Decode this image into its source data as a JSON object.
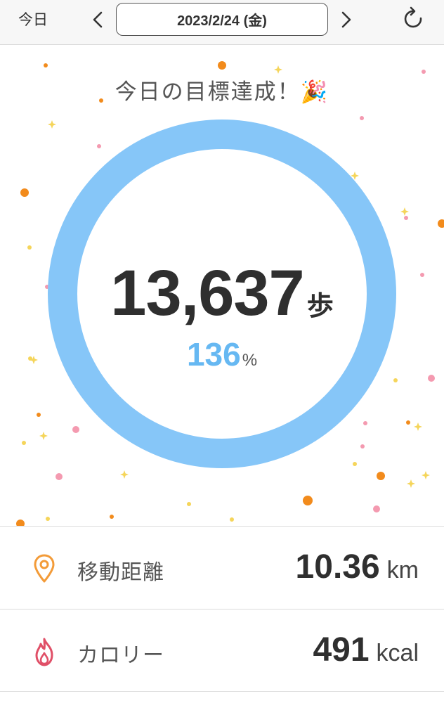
{
  "header": {
    "today_label": "今日",
    "date": "2023/2/24 (金)"
  },
  "main": {
    "goal_message": "今日の目標達成！🎉",
    "steps": "13,637",
    "steps_unit": "歩",
    "achievement_percent": "136",
    "percent_unit": "%",
    "ring_color": "#86c6f8",
    "percent_color": "#66b8f2"
  },
  "stats": {
    "distance": {
      "label": "移動距離",
      "value": "10.36",
      "unit": "km",
      "icon": "location-pin-icon",
      "icon_color": "#f39b38"
    },
    "calorie": {
      "label": "カロリー",
      "value": "491",
      "unit": "kcal",
      "icon": "flame-icon",
      "icon_color": "#e04f67"
    }
  },
  "confetti_colors": [
    "#f28b1c",
    "#f49ab0",
    "#f5d55a"
  ]
}
